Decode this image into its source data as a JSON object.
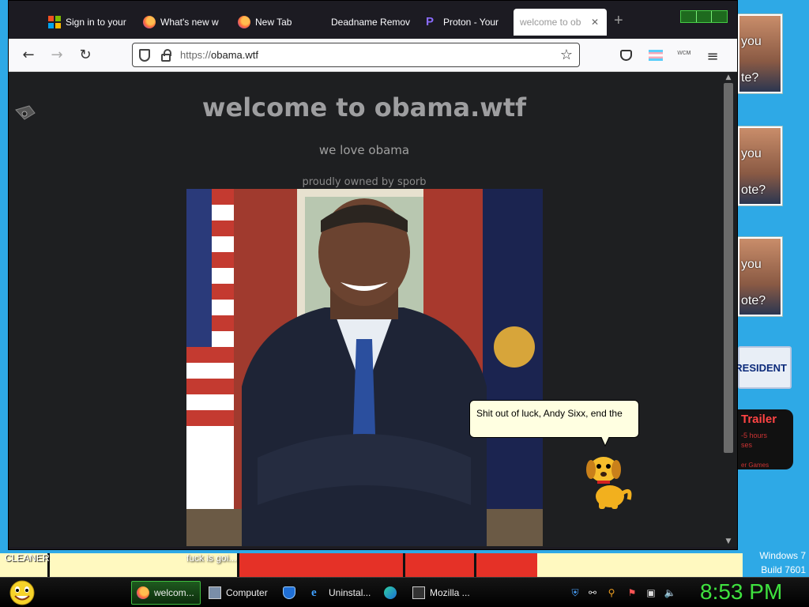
{
  "browser": {
    "tabs": [
      {
        "label": "Sign in to your",
        "icon": "microsoft-icon"
      },
      {
        "label": "What's new w",
        "icon": "firefox-icon"
      },
      {
        "label": "New Tab",
        "icon": "firefox-icon"
      },
      {
        "label": "Deadname Remov",
        "icon": "none"
      },
      {
        "label": "Proton - Your",
        "icon": "proton-icon"
      },
      {
        "label": "welcome to ob",
        "icon": "none",
        "active": true
      }
    ],
    "new_tab_label": "+",
    "url_scheme": "https://",
    "url_host": "obama.wtf",
    "extension_label": "ᴡᴄᴍ"
  },
  "page": {
    "title": "welcome to obama.wtf",
    "subtitle": "we love obama",
    "owner": "proudly owned by sporb"
  },
  "assistant": {
    "speech": "Shit out of luck, Andy Sixx, end the"
  },
  "desktop": {
    "ads": [
      {
        "top": "you",
        "bottom": "te?"
      },
      {
        "top": "you",
        "bottom": "ote?"
      },
      {
        "top": "you",
        "bottom": "ote?"
      }
    ],
    "president_ad": "RESIDENT",
    "trailer_ad": {
      "title": "Trailer",
      "line1": "-5 hours",
      "line2": "ses",
      "line3": "er Games"
    },
    "cleaner_label": "CLEANER",
    "caption": "fuck is goi...",
    "windows_label": "Windows 7",
    "build_label": "Build 7601"
  },
  "taskbar": {
    "tasks": [
      {
        "label": "welcom...",
        "icon": "firefox-icon",
        "active": true
      },
      {
        "label": "Computer",
        "icon": "computer-icon"
      },
      {
        "label": "",
        "icon": "shield-icon"
      },
      {
        "label": "Uninstal...",
        "icon": "ie-icon"
      },
      {
        "label": "",
        "icon": "edge-icon"
      },
      {
        "label": "Mozilla ...",
        "icon": "window-icon"
      }
    ],
    "clock": "8:53 PM"
  },
  "colors": {
    "page_bg": "#1e1f21",
    "title": "#9e9ea0",
    "clock": "#3fe23f",
    "desktop": "#2ea9e6"
  }
}
